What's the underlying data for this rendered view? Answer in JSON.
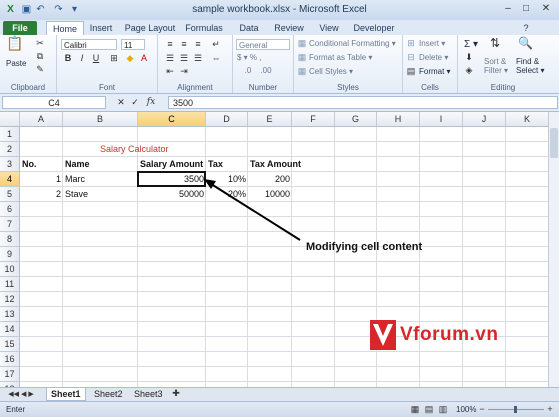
{
  "window": {
    "title": "sample workbook.xlsx - Microsoft Excel",
    "controls": {
      "minimize": "–",
      "maximize": "□",
      "close": "✕"
    }
  },
  "tabs": [
    "File",
    "Home",
    "Insert",
    "Page Layout",
    "Formulas",
    "Data",
    "Review",
    "View",
    "Developer"
  ],
  "ribbon": {
    "clipboard": {
      "paste": "Paste",
      "label": "Clipboard"
    },
    "font": {
      "name": "Calibri",
      "size": "11",
      "label": "Font"
    },
    "alignment": {
      "label": "Alignment"
    },
    "number": {
      "format": "General",
      "currency": "$ ▾ % ,",
      "label": "Number"
    },
    "styles": {
      "conditional": "Conditional Formatting ▾",
      "table": "Format as Table ▾",
      "cell": "Cell Styles ▾",
      "label": "Styles"
    },
    "cells": {
      "insert": "Insert ▾",
      "delete": "Delete ▾",
      "format": "Format ▾",
      "label": "Cells"
    },
    "editing": {
      "sum": "Σ ▾",
      "sort": "Sort & Filter ▾",
      "find": "Find & Select ▾",
      "label": "Editing"
    }
  },
  "formula_bar": {
    "name_box": "C4",
    "fx": "fx",
    "value": "3500"
  },
  "columns": [
    "A",
    "B",
    "C",
    "D",
    "E",
    "F",
    "G",
    "H",
    "I",
    "J",
    "K"
  ],
  "rows": [
    "1",
    "2",
    "3",
    "4",
    "5",
    "6",
    "7",
    "8",
    "9",
    "10",
    "11",
    "12",
    "13",
    "14",
    "15",
    "16",
    "17",
    "18"
  ],
  "cells": {
    "title": "Salary Calculator",
    "headers": {
      "no": "No.",
      "name": "Name",
      "salary": "Salary Amount",
      "tax": "Tax",
      "tax_amount": "Tax Amount"
    },
    "row4": {
      "no": "1",
      "name": "Marc",
      "salary": "3500",
      "tax": "10%",
      "tax_amount": "200"
    },
    "row5": {
      "no": "2",
      "name": "Stave",
      "salary": "50000",
      "tax": "20%",
      "tax_amount": "10000"
    }
  },
  "annotation": "Modifying cell content",
  "watermark": "Vforum.vn",
  "sheets": [
    "Sheet1",
    "Sheet2",
    "Sheet3"
  ],
  "status": {
    "mode": "Enter",
    "zoom": "100%"
  },
  "colors": {
    "accent": "#2d7d3a",
    "title_red": "#c0392b",
    "watermark_red": "#d9262b"
  }
}
